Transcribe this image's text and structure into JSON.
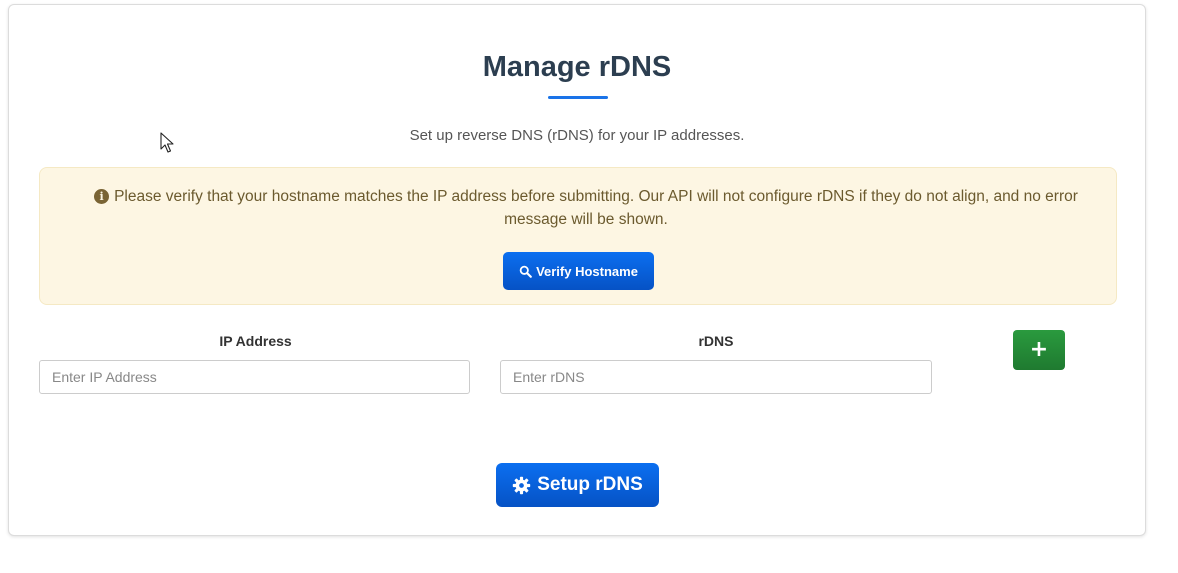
{
  "page": {
    "title": "Manage rDNS",
    "subtitle": "Set up reverse DNS (rDNS) for your IP addresses."
  },
  "alert": {
    "icon": "info-circle-icon",
    "message": "Please verify that your hostname matches the IP address before submitting. Our API will not configure rDNS if they do not align, and no error message will be shown.",
    "verify_button": "Verify Hostname",
    "verify_icon": "search-icon"
  },
  "form": {
    "ip_label": "IP Address",
    "ip_placeholder": "Enter IP Address",
    "ip_value": "",
    "rdns_label": "rDNS",
    "rdns_placeholder": "Enter rDNS",
    "rdns_value": "",
    "add_button": "+",
    "submit_button": "Setup rDNS",
    "submit_icon": "gear-icon"
  },
  "colors": {
    "primary": "#0b6ff0",
    "success": "#2a9a3e",
    "alert_bg": "#fdf6e3",
    "title": "#2c3e50"
  }
}
